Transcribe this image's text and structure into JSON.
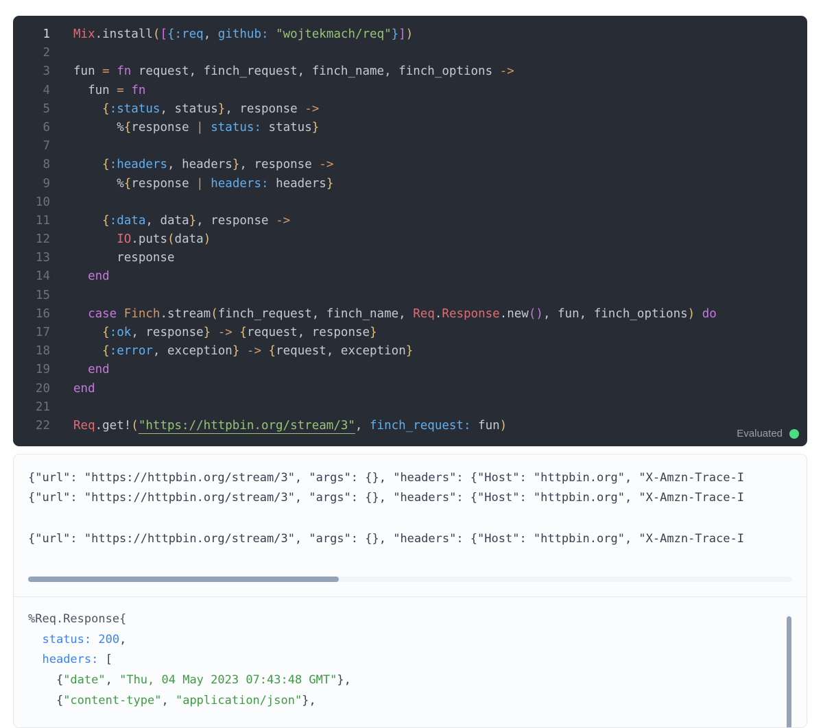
{
  "cell": {
    "line_numbers": [
      "1",
      "2",
      "3",
      "4",
      "5",
      "6",
      "7",
      "8",
      "9",
      "10",
      "11",
      "12",
      "13",
      "14",
      "15",
      "16",
      "17",
      "18",
      "19",
      "20",
      "21",
      "22"
    ],
    "lines": [
      [
        [
          "t-mod",
          "Mix"
        ],
        [
          "t-txt",
          ".install"
        ],
        [
          "t-b1",
          "("
        ],
        [
          "t-b2",
          "["
        ],
        [
          "t-b3",
          "{"
        ],
        [
          "t-atom",
          ":req"
        ],
        [
          "t-txt",
          ", "
        ],
        [
          "t-key",
          "github:"
        ],
        [
          "t-txt",
          " "
        ],
        [
          "t-str",
          "\"wojtekmach/req\""
        ],
        [
          "t-b3",
          "}"
        ],
        [
          "t-b2",
          "]"
        ],
        [
          "t-b1",
          ")"
        ]
      ],
      [],
      [
        [
          "t-txt",
          "fun "
        ],
        [
          "t-op",
          "="
        ],
        [
          "t-txt",
          " "
        ],
        [
          "t-kw",
          "fn"
        ],
        [
          "t-txt",
          " request, finch_request, finch_name, finch_options "
        ],
        [
          "t-op",
          "->"
        ]
      ],
      [
        [
          "t-txt",
          "  fun "
        ],
        [
          "t-op",
          "="
        ],
        [
          "t-txt",
          " "
        ],
        [
          "t-kw",
          "fn"
        ]
      ],
      [
        [
          "t-txt",
          "    "
        ],
        [
          "t-b1",
          "{"
        ],
        [
          "t-atom",
          ":status"
        ],
        [
          "t-txt",
          ", status"
        ],
        [
          "t-b1",
          "}"
        ],
        [
          "t-txt",
          ", response "
        ],
        [
          "t-op",
          "->"
        ]
      ],
      [
        [
          "t-txt",
          "      %"
        ],
        [
          "t-b1",
          "{"
        ],
        [
          "t-txt",
          "response "
        ],
        [
          "t-op",
          "|"
        ],
        [
          "t-txt",
          " "
        ],
        [
          "t-key",
          "status:"
        ],
        [
          "t-txt",
          " status"
        ],
        [
          "t-b1",
          "}"
        ]
      ],
      [],
      [
        [
          "t-txt",
          "    "
        ],
        [
          "t-b1",
          "{"
        ],
        [
          "t-atom",
          ":headers"
        ],
        [
          "t-txt",
          ", headers"
        ],
        [
          "t-b1",
          "}"
        ],
        [
          "t-txt",
          ", response "
        ],
        [
          "t-op",
          "->"
        ]
      ],
      [
        [
          "t-txt",
          "      %"
        ],
        [
          "t-b1",
          "{"
        ],
        [
          "t-txt",
          "response "
        ],
        [
          "t-op",
          "|"
        ],
        [
          "t-txt",
          " "
        ],
        [
          "t-key",
          "headers:"
        ],
        [
          "t-txt",
          " headers"
        ],
        [
          "t-b1",
          "}"
        ]
      ],
      [],
      [
        [
          "t-txt",
          "    "
        ],
        [
          "t-b1",
          "{"
        ],
        [
          "t-atom",
          ":data"
        ],
        [
          "t-txt",
          ", data"
        ],
        [
          "t-b1",
          "}"
        ],
        [
          "t-txt",
          ", response "
        ],
        [
          "t-op",
          "->"
        ]
      ],
      [
        [
          "t-txt",
          "      "
        ],
        [
          "t-mod",
          "IO"
        ],
        [
          "t-txt",
          ".puts"
        ],
        [
          "t-b1",
          "("
        ],
        [
          "t-txt",
          "data"
        ],
        [
          "t-b1",
          ")"
        ]
      ],
      [
        [
          "t-txt",
          "      response"
        ]
      ],
      [
        [
          "t-kw",
          "  end"
        ]
      ],
      [],
      [
        [
          "t-kw",
          "  case"
        ],
        [
          "t-txt",
          " "
        ],
        [
          "t-op",
          "Finch"
        ],
        [
          "t-txt",
          ".stream"
        ],
        [
          "t-b1",
          "("
        ],
        [
          "t-txt",
          "finch_request, finch_name, "
        ],
        [
          "t-mod",
          "Req"
        ],
        [
          "t-txt",
          "."
        ],
        [
          "t-mod",
          "Response"
        ],
        [
          "t-txt",
          ".new"
        ],
        [
          "t-b2",
          "()"
        ],
        [
          "t-txt",
          ", fun, finch_options"
        ],
        [
          "t-b1",
          ")"
        ],
        [
          "t-txt",
          " "
        ],
        [
          "t-kw",
          "do"
        ]
      ],
      [
        [
          "t-txt",
          "    "
        ],
        [
          "t-b1",
          "{"
        ],
        [
          "t-atom",
          ":ok"
        ],
        [
          "t-txt",
          ", response"
        ],
        [
          "t-b1",
          "}"
        ],
        [
          "t-txt",
          " "
        ],
        [
          "t-op",
          "->"
        ],
        [
          "t-txt",
          " "
        ],
        [
          "t-b1",
          "{"
        ],
        [
          "t-txt",
          "request, response"
        ],
        [
          "t-b1",
          "}"
        ]
      ],
      [
        [
          "t-txt",
          "    "
        ],
        [
          "t-b1",
          "{"
        ],
        [
          "t-atom",
          ":error"
        ],
        [
          "t-txt",
          ", exception"
        ],
        [
          "t-b1",
          "}"
        ],
        [
          "t-txt",
          " "
        ],
        [
          "t-op",
          "->"
        ],
        [
          "t-txt",
          " "
        ],
        [
          "t-b1",
          "{"
        ],
        [
          "t-txt",
          "request, exception"
        ],
        [
          "t-b1",
          "}"
        ]
      ],
      [
        [
          "t-kw",
          "  end"
        ]
      ],
      [
        [
          "t-kw",
          "end"
        ]
      ],
      [],
      [
        [
          "t-mod",
          "Req"
        ],
        [
          "t-txt",
          ".get!"
        ],
        [
          "t-b1",
          "("
        ],
        [
          "t-str t-link",
          "\"https://httpbin.org/stream/3\""
        ],
        [
          "t-txt",
          ", "
        ],
        [
          "t-key",
          "finch_request:"
        ],
        [
          "t-txt",
          " fun"
        ],
        [
          "t-b1",
          ")"
        ]
      ]
    ],
    "status_label": "Evaluated",
    "status_color": "#4ade80"
  },
  "output": {
    "stream_lines": [
      "{\"url\": \"https://httpbin.org/stream/3\", \"args\": {}, \"headers\": {\"Host\": \"httpbin.org\", \"X-Amzn-Trace-I",
      "{\"url\": \"https://httpbin.org/stream/3\", \"args\": {}, \"headers\": {\"Host\": \"httpbin.org\", \"X-Amzn-Trace-I",
      "{\"url\": \"https://httpbin.org/stream/3\", \"args\": {}, \"headers\": {\"Host\": \"httpbin.org\", \"X-Amzn-Trace-I"
    ],
    "result_lines": [
      [
        [
          "r-mod",
          "%Req.Response{"
        ]
      ],
      [
        [
          "r-txt",
          "  "
        ],
        [
          "r-atom",
          "status:"
        ],
        [
          "r-txt",
          " "
        ],
        [
          "r-num",
          "200"
        ],
        [
          "r-txt",
          ","
        ]
      ],
      [
        [
          "r-txt",
          "  "
        ],
        [
          "r-atom",
          "headers:"
        ],
        [
          "r-txt",
          " ["
        ]
      ],
      [
        [
          "r-txt",
          "    {"
        ],
        [
          "r-str",
          "\"date\""
        ],
        [
          "r-txt",
          ", "
        ],
        [
          "r-str",
          "\"Thu, 04 May 2023 07:43:48 GMT\""
        ],
        [
          "r-txt",
          "},"
        ]
      ],
      [
        [
          "r-txt",
          "    {"
        ],
        [
          "r-str",
          "\"content-type\""
        ],
        [
          "r-txt",
          ", "
        ],
        [
          "r-str",
          "\"application/json\""
        ],
        [
          "r-txt",
          "},"
        ]
      ]
    ]
  }
}
